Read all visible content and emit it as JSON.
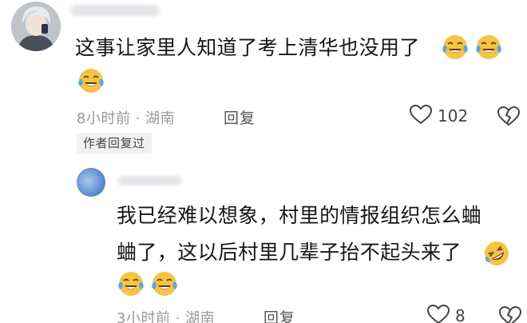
{
  "comments": [
    {
      "text": "这事让家里人知道了考上清华也没用了",
      "emojis": [
        "crying-laughing",
        "crying-laughing",
        "crying-laughing"
      ],
      "time": "8小时前",
      "location": "湖南",
      "reply_label": "回复",
      "likes": "102",
      "author_replied": "作者回复过"
    },
    {
      "text_line1": "我已经难以想象，村里的情报组织怎么蛐",
      "text_line2": "蛐了，这以后村里几辈子抬不起头来了",
      "emojis": [
        "rofl",
        "crying-laughing",
        "crying-laughing"
      ],
      "time": "3小时前",
      "location": "湖南",
      "reply_label": "回复",
      "likes": "8"
    }
  ],
  "separator": "·",
  "colors": {
    "meta_text": "#999999",
    "body_text": "#161616",
    "emoji_yellow": "#f6c445",
    "tear_blue": "#5aa8e6"
  }
}
